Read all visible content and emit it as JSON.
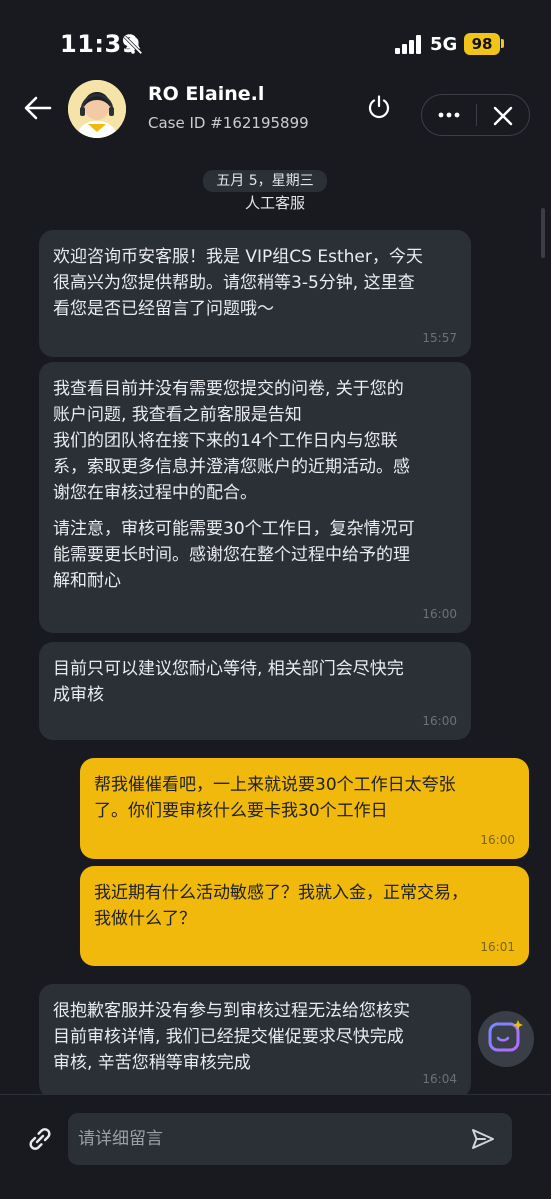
{
  "status_bar": {
    "time": "11:39",
    "network": "5G",
    "battery": "98"
  },
  "header": {
    "agent_name": "RO Elaine.l",
    "case_id": "Case ID #162195899"
  },
  "date_chip": "五月 5，星期三",
  "system_label": "人工客服",
  "messages": [
    {
      "side": "in",
      "paragraphs": [
        "欢迎咨询币安客服！我是 VIP组CS Esther，今天\n很高兴为您提供帮助。请您稍等3-5分钟, 这里查\n看您是否已经留言了问题哦～"
      ],
      "time": "15:57"
    },
    {
      "side": "in",
      "paragraphs": [
        "我查看目前并没有需要您提交的问卷, 关于您的\n账户问题, 我查看之前客服是告知\n我们的团队将在接下来的14个工作日内与您联\n系，索取更多信息并澄清您账户的近期活动。感\n谢您在审核过程中的配合。",
        "请注意，审核可能需要30个工作日，复杂情况可\n能需要更长时间。感谢您在整个过程中给予的理\n解和耐心"
      ],
      "time": "16:00"
    },
    {
      "side": "in",
      "paragraphs": [
        "目前只可以建议您耐心等待, 相关部门会尽快完\n成审核"
      ],
      "time": "16:00"
    },
    {
      "side": "out",
      "paragraphs": [
        "帮我催催看吧，一上来就说要30个工作日太夸张\n了。你们要审核什么要卡我30个工作日"
      ],
      "time": "16:00"
    },
    {
      "side": "out",
      "paragraphs": [
        "我近期有什么活动敏感了？我就入金，正常交易，\n我做什么了？"
      ],
      "time": "16:01"
    },
    {
      "side": "in",
      "paragraphs": [
        "很抱歉客服并没有参与到审核过程无法给您核实\n目前审核详情, 我们已经提交催促要求尽快完成\n审核, 辛苦您稍等审核完成"
      ],
      "time": "16:04"
    }
  ],
  "input": {
    "placeholder": "请详细留言"
  },
  "colors": {
    "background": "#181a20",
    "incoming_bubble": "#2b2f36",
    "outgoing_bubble": "#f0b90b",
    "battery": "#f0c419"
  },
  "icons": [
    "bell-off-icon",
    "signal-icon",
    "back-arrow-icon",
    "power-icon",
    "more-dots-icon",
    "close-icon",
    "link-icon",
    "send-icon",
    "assistant-icon"
  ]
}
